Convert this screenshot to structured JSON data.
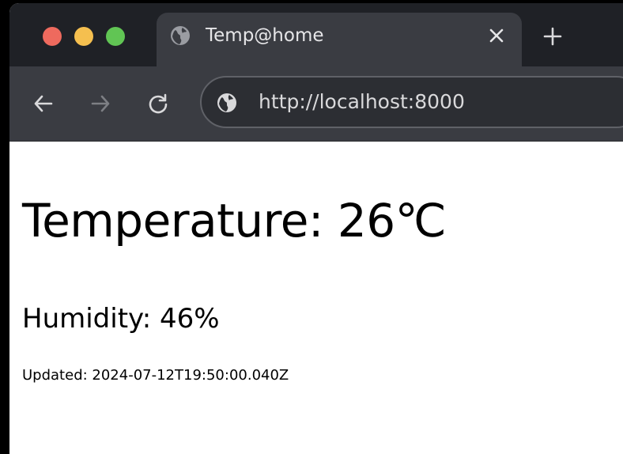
{
  "browser": {
    "tab": {
      "title": "Temp@home",
      "icon": "globe-icon",
      "close_icon": "close-icon"
    },
    "new_tab_icon": "plus-icon",
    "nav": {
      "back_icon": "arrow-left-icon",
      "forward_icon": "arrow-right-icon",
      "reload_icon": "reload-icon"
    },
    "address_bar": {
      "url": "http://localhost:8000",
      "icon": "globe-icon"
    },
    "colors": {
      "traffic_close": "#ee6a5e",
      "traffic_minimize": "#f5bf4f",
      "traffic_maximize": "#61c554",
      "chrome_dark": "#1f2126",
      "chrome_toolbar": "#3a3c42"
    }
  },
  "page": {
    "temperature": "Temperature: 26℃",
    "humidity": "Humidity: 46%",
    "updated": "Updated: 2024-07-12T19:50:00.040Z"
  }
}
